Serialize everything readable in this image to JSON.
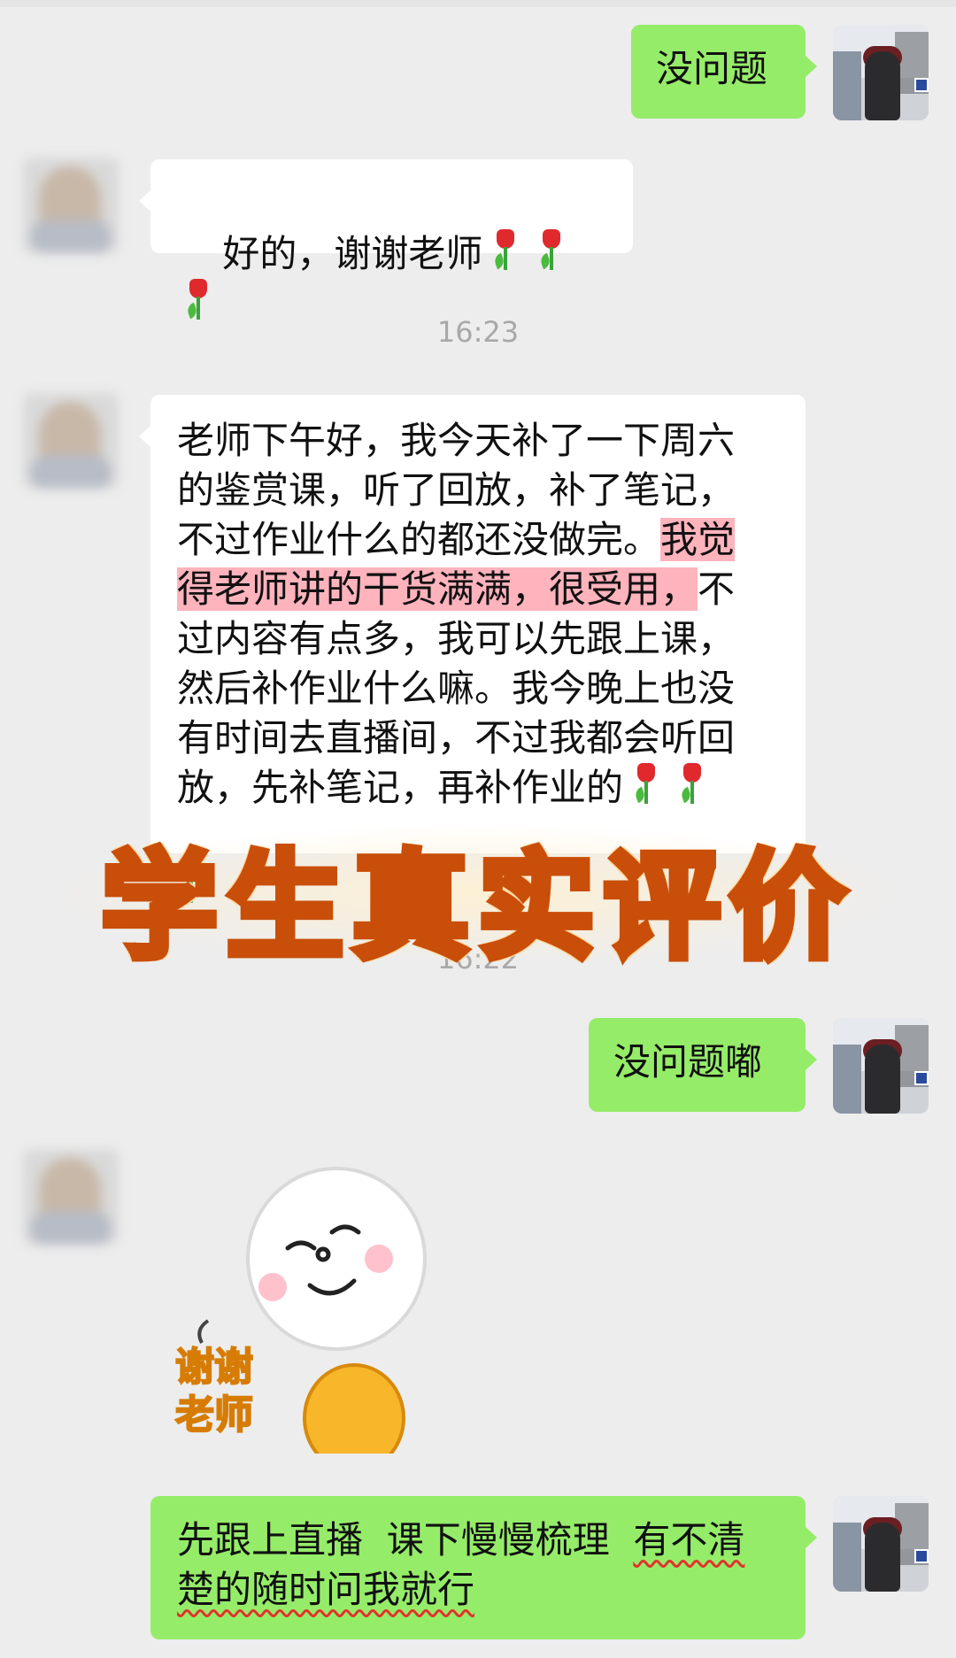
{
  "chat": {
    "messages": [
      {
        "id": "m1",
        "side": "right",
        "text": "没问题"
      },
      {
        "id": "m2",
        "side": "left",
        "text": "好的，谢谢老师"
      },
      {
        "id": "m3",
        "side": "left",
        "part1": "老师下午好，我今天补了一下周六\n的鉴赏课，听了回放，补了笔记，\n不过作业什么的都还没做完。",
        "highlight": "我觉\n得老师讲的干货满满，很受用，",
        "part2": "不\n过内容有点多，我可以先跟上课，\n然后补作业什么嘛。我今晚上也没\n有时间去直播间，不过我都会听回\n放，先补笔记，再补作业的"
      },
      {
        "id": "m4",
        "side": "right",
        "text": "没问题嘟"
      },
      {
        "id": "m5",
        "side": "left",
        "sticker_text": "谢谢\n老师"
      },
      {
        "id": "m6",
        "side": "right",
        "part1": "先跟上直播  课下慢慢梳理  ",
        "underlined": "有不清\n楚的随时问我就行"
      }
    ],
    "timestamps": [
      "16:23",
      "16:22"
    ]
  },
  "overlay": {
    "title": "学生真实评价"
  },
  "icons": {
    "tulip": "tulip-icon",
    "sticker": "smiley-bow-sticker"
  },
  "colors": {
    "background": "#ededed",
    "bubble_green": "#95ec69",
    "bubble_white": "#ffffff",
    "highlight": "#ffb3bd",
    "overlay_fill": "#ffb52a",
    "overlay_stroke": "#c84e0a"
  }
}
